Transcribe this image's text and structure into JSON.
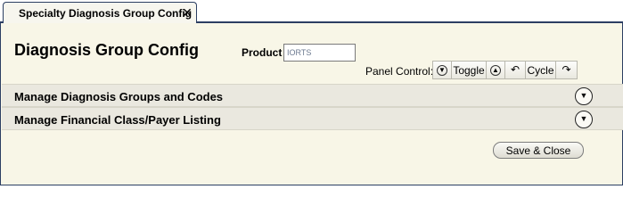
{
  "tab": {
    "label": "Specialty Diagnosis Group Config",
    "close_glyph": "✕"
  },
  "page": {
    "title": "Diagnosis Group Config"
  },
  "product": {
    "label": "Product",
    "value": "IORTS"
  },
  "panel_control": {
    "label": "Panel Control:",
    "toggle_label": "Toggle",
    "cycle_label": "Cycle",
    "icons": [
      "collapse-down-icon",
      "collapse-up-icon",
      "undo-arrow-icon",
      "redo-arrow-icon"
    ]
  },
  "sections": [
    {
      "title": "Manage Diagnosis Groups and Codes",
      "icon": "chevron-down-icon"
    },
    {
      "title": "Manage Financial Class/Payer Listing",
      "icon": "chevron-down-icon"
    }
  ],
  "actions": {
    "save_close_label": "Save & Close"
  },
  "colors": {
    "content_bg": "#f8f6e7",
    "section_bg": "#eae8df",
    "border": "#2c3f63"
  }
}
